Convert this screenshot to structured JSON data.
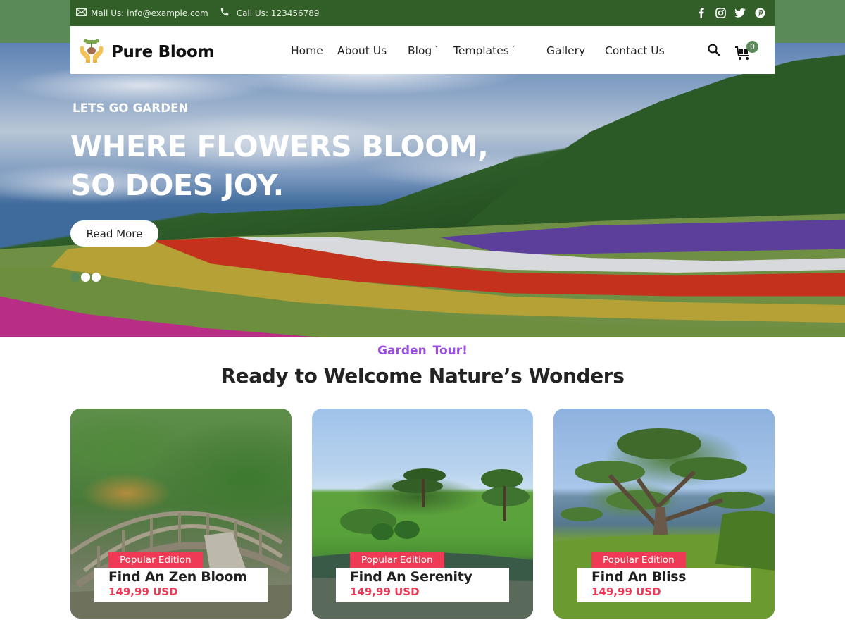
{
  "topbar": {
    "mail_label": "Mail Us: info@example.com",
    "phone_label": "Call Us: 123456789",
    "social": [
      {
        "name": "facebook",
        "icon": "facebook-icon"
      },
      {
        "name": "instagram",
        "icon": "instagram-icon"
      },
      {
        "name": "twitter",
        "icon": "twitter-icon"
      },
      {
        "name": "pinterest",
        "icon": "pinterest-icon"
      }
    ]
  },
  "header": {
    "brand": "Pure Bloom",
    "nav": [
      {
        "label": "Home",
        "has_dropdown": false
      },
      {
        "label": "About Us",
        "has_dropdown": false
      },
      {
        "label": "Blog",
        "has_dropdown": true
      },
      {
        "label": "Templates",
        "has_dropdown": true
      },
      {
        "label": "Gallery",
        "has_dropdown": false
      },
      {
        "label": "Contact Us",
        "has_dropdown": false
      }
    ],
    "caret": "˅",
    "cart_count": "0"
  },
  "hero": {
    "eyebrow": "LETS GO GARDEN",
    "title_line1": "WHERE FLOWERS BLOOM,",
    "title_line2": "SO DOES JOY.",
    "cta_label": "Read More",
    "slides": 3,
    "active_slide": 1
  },
  "section": {
    "eyebrow": "Garden  Tour!",
    "title": "Ready to Welcome Nature’s Wonders"
  },
  "cards": [
    {
      "tag": "Popular Edition",
      "title": "Find An Zen Bloom",
      "price": "149,99 USD"
    },
    {
      "tag": "Popular Edition",
      "title": "Find An Serenity",
      "price": "149,99 USD"
    },
    {
      "tag": "Popular Edition",
      "title": "Find An Bliss",
      "price": "149,99 USD"
    }
  ],
  "colors": {
    "topbar_bg": "#325f28",
    "accent_green": "#5a8a58",
    "tag_red": "#ef3a56",
    "price_red": "#ec3a57",
    "eyebrow_purple": "#9a4ee4"
  }
}
